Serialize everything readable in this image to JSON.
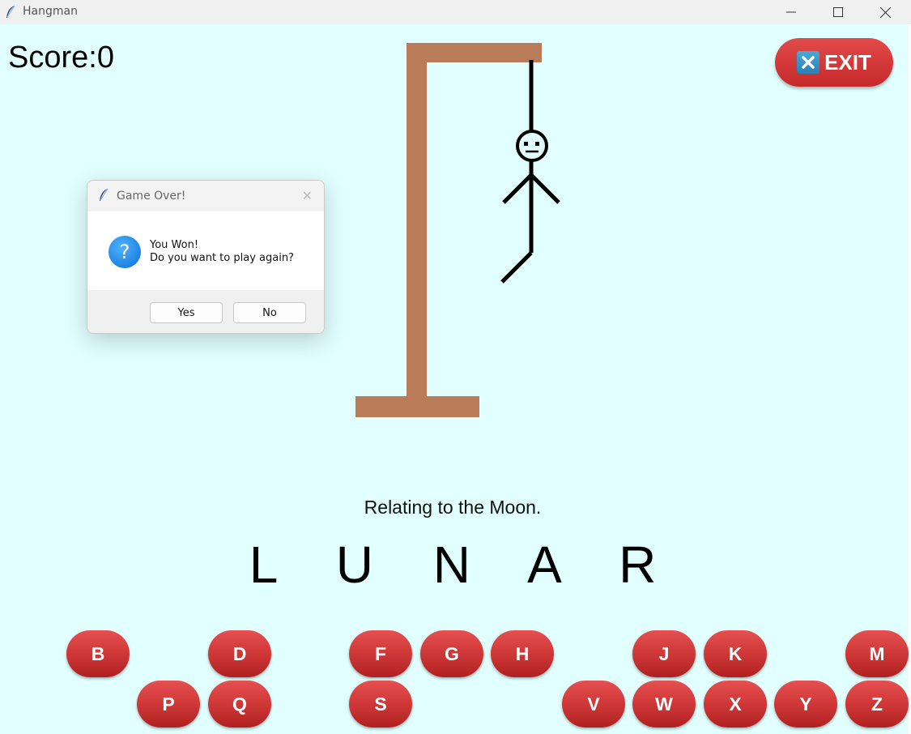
{
  "window": {
    "title": "Hangman"
  },
  "score": {
    "text": "Score:0"
  },
  "exit": {
    "label": "EXIT"
  },
  "hint": {
    "text": "Relating to the Moon."
  },
  "word": {
    "text": "L U N A R"
  },
  "keys": {
    "B": "B",
    "D": "D",
    "F": "F",
    "G": "G",
    "H": "H",
    "J": "J",
    "K": "K",
    "M": "M",
    "P": "P",
    "Q": "Q",
    "S": "S",
    "V": "V",
    "W": "W",
    "X": "X",
    "Y": "Y",
    "Z": "Z"
  },
  "dialog": {
    "title": "Game Over!",
    "line1": "You Won!",
    "line2": "Do you want to play again?",
    "yes": "Yes",
    "no": "No"
  },
  "colors": {
    "background": "#e1ffff",
    "gallows": "#b97b58",
    "key": "#d23a3a",
    "dialog_icon": "#0a6fd6"
  },
  "icons": {
    "app": "feather-icon",
    "exit": "close-icon",
    "dialog": "question-icon"
  }
}
